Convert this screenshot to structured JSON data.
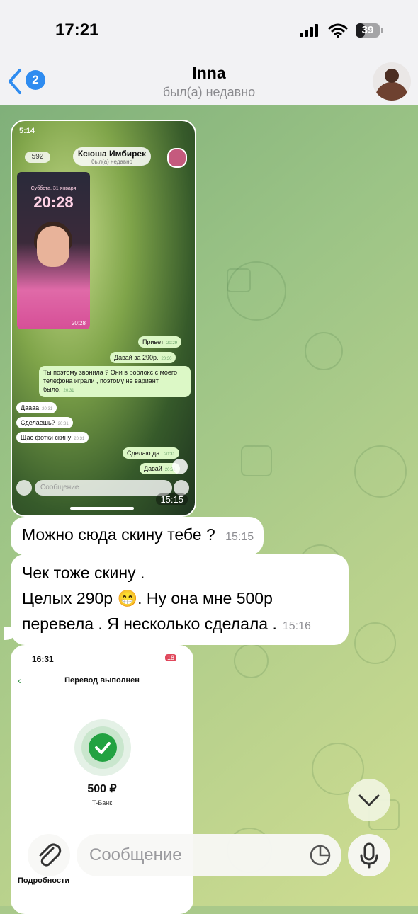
{
  "status_bar": {
    "time": "17:21",
    "battery": "39",
    "battery_level": 0.39
  },
  "header": {
    "back_count": "2",
    "title": "Inna",
    "subtitle": "был(а) недавно"
  },
  "photo1": {
    "status_time": "5:14",
    "back_count": "592",
    "contact_name": "Ксюша Имбирек",
    "contact_status": "был(а) недавно",
    "lock_date": "Суббота, 31 января",
    "lock_time": "20:28",
    "lock_small_time": "20:28",
    "messages": [
      {
        "text": "Привет",
        "time": "20:29"
      },
      {
        "text": "Давай за 290р.",
        "time": "20:30"
      },
      {
        "text": "Ты поэтому звонила ? Они в роблокс с моего телефона играли , поэтому не вариант было.",
        "time": "20:31"
      },
      {
        "text": "Даааа",
        "time": "20:31"
      },
      {
        "text": "Сделаешь?",
        "time": "20:31"
      },
      {
        "text": "Щас фотки скину",
        "time": "20:31"
      },
      {
        "text": "Сделаю да.",
        "time": "20:31"
      },
      {
        "text": "Давай",
        "time": "20:31"
      }
    ],
    "input_placeholder": "Сообщение",
    "timestamp": "15:15"
  },
  "messages": [
    {
      "text": "Можно сюда скину тебе ?",
      "time": "15:15"
    },
    {
      "lines": [
        "Чек тоже скину .",
        "Целых 290р 😁. Ну она мне 500р",
        "перевела . Я несколько сделала ."
      ],
      "time": "15:16"
    }
  ],
  "photo2": {
    "status_time": "16:31",
    "battery": "18",
    "title": "Перевод выполнен",
    "amount": "500 ₽",
    "bank": "Т-Банк",
    "details": "Подробности"
  },
  "composer": {
    "placeholder": "Сообщение"
  },
  "colors": {
    "accent": "#2f8cf0",
    "outgoing_bubble": "#dcf8c6",
    "success": "#22a241"
  },
  "icons": [
    "back-chevron-icon",
    "signal-icon",
    "wifi-icon",
    "battery-icon",
    "attach-icon",
    "sticker-icon",
    "mic-icon",
    "chevron-down-icon",
    "check-icon"
  ]
}
